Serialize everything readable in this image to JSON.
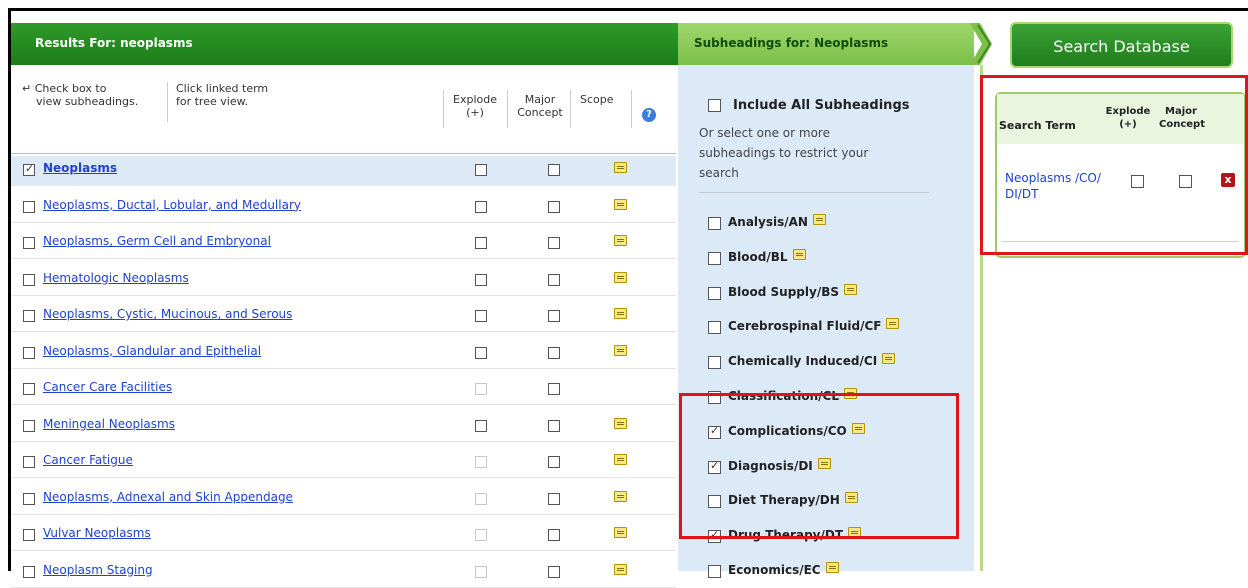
{
  "left_header": "Results For: neoplasms",
  "mid_header": "Subheadings for: Neoplasms",
  "search_button": "Search Database",
  "instructions": {
    "check_line1": "Check box to",
    "check_line2": "view subheadings.",
    "click_line1": "Click linked term",
    "click_line2": "for tree view."
  },
  "columns": {
    "explode_1": "Explode",
    "explode_2": "(+)",
    "major_1": "Major",
    "major_2": "Concept",
    "scope": "Scope"
  },
  "terms": [
    {
      "label": "Neoplasms",
      "checked": true,
      "explode_enabled": true,
      "scope": true
    },
    {
      "label": "Neoplasms, Ductal, Lobular, and Medullary",
      "checked": false,
      "explode_enabled": true,
      "scope": true
    },
    {
      "label": "Neoplasms, Germ Cell and Embryonal",
      "checked": false,
      "explode_enabled": true,
      "scope": true
    },
    {
      "label": "Hematologic Neoplasms",
      "checked": false,
      "explode_enabled": true,
      "scope": true
    },
    {
      "label": "Neoplasms, Cystic, Mucinous, and Serous",
      "checked": false,
      "explode_enabled": true,
      "scope": true
    },
    {
      "label": "Neoplasms, Glandular and Epithelial",
      "checked": false,
      "explode_enabled": true,
      "scope": true
    },
    {
      "label": "Cancer Care Facilities",
      "checked": false,
      "explode_enabled": false,
      "scope": false
    },
    {
      "label": "Meningeal Neoplasms",
      "checked": false,
      "explode_enabled": true,
      "scope": true
    },
    {
      "label": "Cancer Fatigue",
      "checked": false,
      "explode_enabled": false,
      "scope": true
    },
    {
      "label": "Neoplasms, Adnexal and Skin Appendage",
      "checked": false,
      "explode_enabled": false,
      "scope": true
    },
    {
      "label": "Vulvar Neoplasms",
      "checked": false,
      "explode_enabled": false,
      "scope": true
    },
    {
      "label": "Neoplasm Staging",
      "checked": false,
      "explode_enabled": false,
      "scope": true
    }
  ],
  "subheadings": {
    "include_all": "Include All Subheadings",
    "help_text": "Or select one or more subheadings to restrict your search",
    "items": [
      {
        "label": "Analysis/AN",
        "checked": false
      },
      {
        "label": "Blood/BL",
        "checked": false
      },
      {
        "label": "Blood Supply/BS",
        "checked": false
      },
      {
        "label": "Cerebrospinal Fluid/CF",
        "checked": false
      },
      {
        "label": "Chemically Induced/CI",
        "checked": false
      },
      {
        "label": "Classification/CL",
        "checked": false
      },
      {
        "label": "Complications/CO",
        "checked": true
      },
      {
        "label": "Diagnosis/DI",
        "checked": true
      },
      {
        "label": "Diet Therapy/DH",
        "checked": false
      },
      {
        "label": "Drug Therapy/DT",
        "checked": true
      },
      {
        "label": "Economics/EC",
        "checked": false
      }
    ]
  },
  "search_terms": {
    "col_term": "Search Term",
    "col_explode_1": "Explode",
    "col_explode_2": "(+)",
    "col_major_1": "Major",
    "col_major_2": "Concept",
    "entry_line1": "Neoplasms /CO/",
    "entry_line2": "DI/DT"
  },
  "colors": {
    "green_dark": "#1d7d1a",
    "green_light": "#9fd66a",
    "link": "#1f43c9",
    "highlight": "#e0141b",
    "mid_bg": "#dce9f7"
  }
}
